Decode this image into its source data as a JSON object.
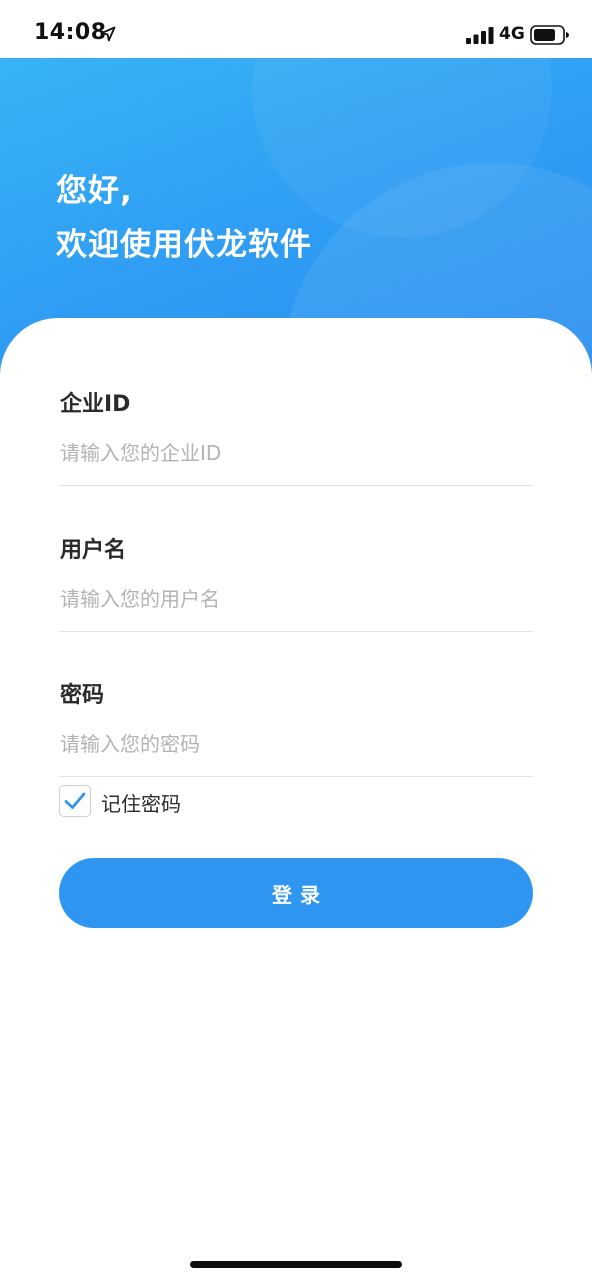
{
  "status_bar": {
    "time": "14:08",
    "network": "4G",
    "location_icon": "location-arrow-icon",
    "signal_icon": "cellular-signal-icon",
    "battery_icon": "battery-icon"
  },
  "header": {
    "greeting_line1": "您好,",
    "greeting_line2": "欢迎使用伏龙软件"
  },
  "form": {
    "company_id": {
      "label": "企业ID",
      "placeholder": "请输入您的企业ID",
      "value": ""
    },
    "username": {
      "label": "用户名",
      "placeholder": "请输入您的用户名",
      "value": ""
    },
    "password": {
      "label": "密码",
      "placeholder": "请输入您的密码",
      "value": ""
    },
    "remember": {
      "label": "记住密码",
      "checked": true,
      "icon": "checkmark-icon"
    },
    "login_label": "登录"
  },
  "colors": {
    "header_gradient_start": "#38b3f6",
    "header_gradient_end": "#2a8cee",
    "accent": "#2e96f0",
    "checkmark": "#2e96f0",
    "placeholder": "#b3b3b3",
    "label": "#2b2b2b"
  }
}
